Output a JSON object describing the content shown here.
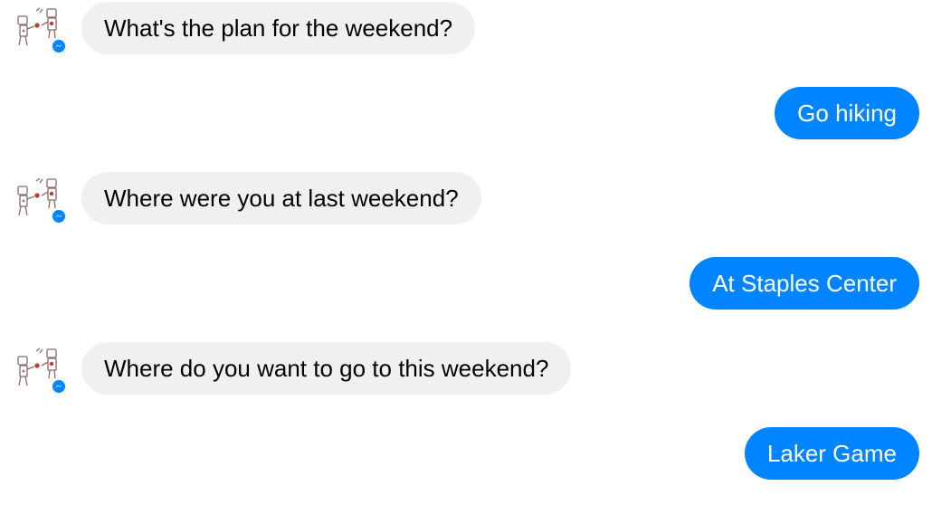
{
  "conversation": {
    "messages": [
      {
        "sender": "bot",
        "text": "What's the plan for the weekend?"
      },
      {
        "sender": "user",
        "text": "Go hiking"
      },
      {
        "sender": "bot",
        "text": "Where were you at last weekend?"
      },
      {
        "sender": "user",
        "text": "At Staples Center"
      },
      {
        "sender": "bot",
        "text": "Where do you want to go to this weekend?"
      },
      {
        "sender": "user",
        "text": "Laker Game"
      }
    ]
  },
  "theme": {
    "incoming_bubble_color": "#f1f0f0",
    "outgoing_bubble_color": "#0084ff",
    "badge_color": "#0084ff"
  },
  "icons": {
    "avatar": "robot-sketch-avatar",
    "badge": "messenger-logo-icon"
  }
}
